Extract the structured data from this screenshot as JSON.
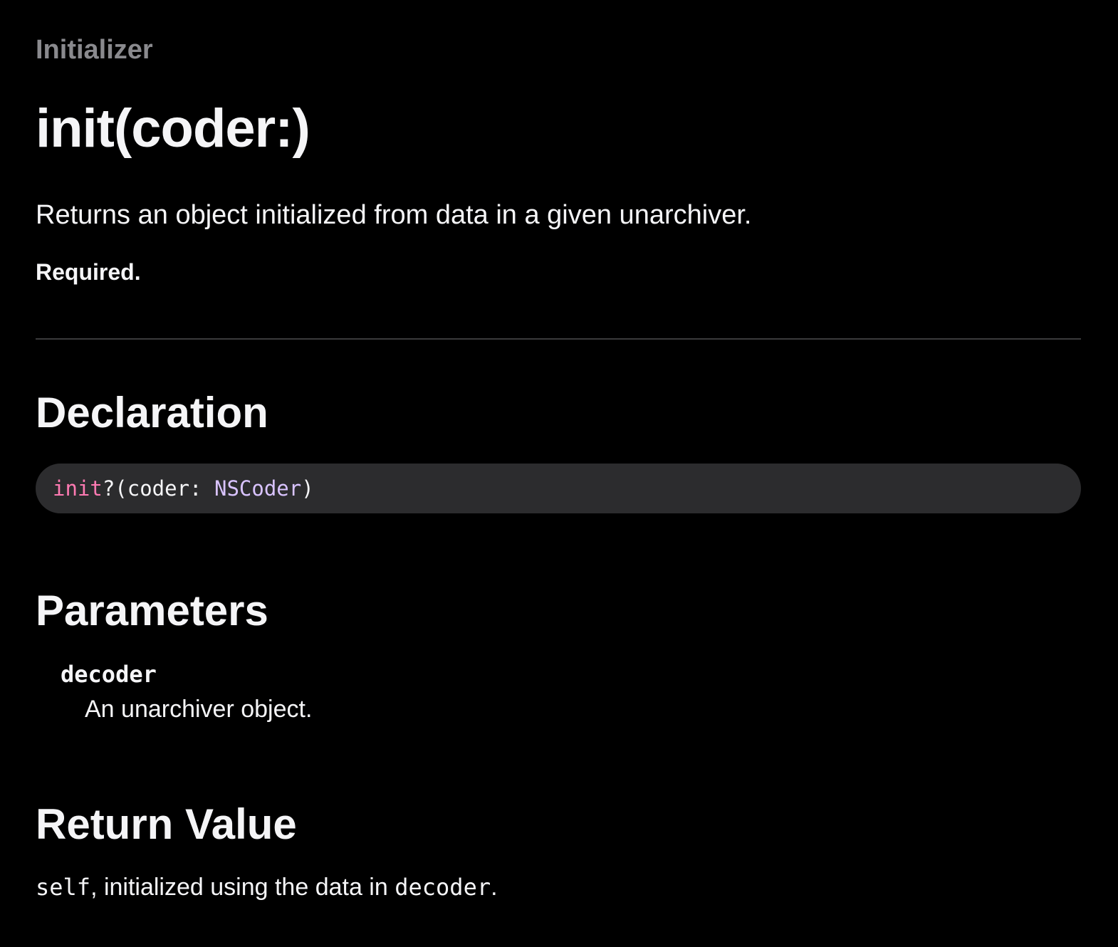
{
  "header": {
    "eyebrow": "Initializer",
    "title": "init(coder:)",
    "abstract": "Returns an object initialized from data in a given unarchiver.",
    "required": "Required."
  },
  "declaration": {
    "heading": "Declaration",
    "code": {
      "keyword": "init",
      "plain_1": "?(coder: ",
      "type": "NSCoder",
      "plain_2": ")"
    }
  },
  "parameters": {
    "heading": "Parameters",
    "items": [
      {
        "name": "decoder",
        "description": "An unarchiver object."
      }
    ]
  },
  "return_value": {
    "heading": "Return Value",
    "code_1": "self",
    "text_1": ", initialized using the data in ",
    "code_2": "decoder",
    "text_2": "."
  },
  "colors": {
    "background": "#000000",
    "eyebrow": "#8a8a8e",
    "code_background": "#2c2c2e",
    "keyword": "#ff7ab2",
    "type": "#d9c3ff"
  }
}
